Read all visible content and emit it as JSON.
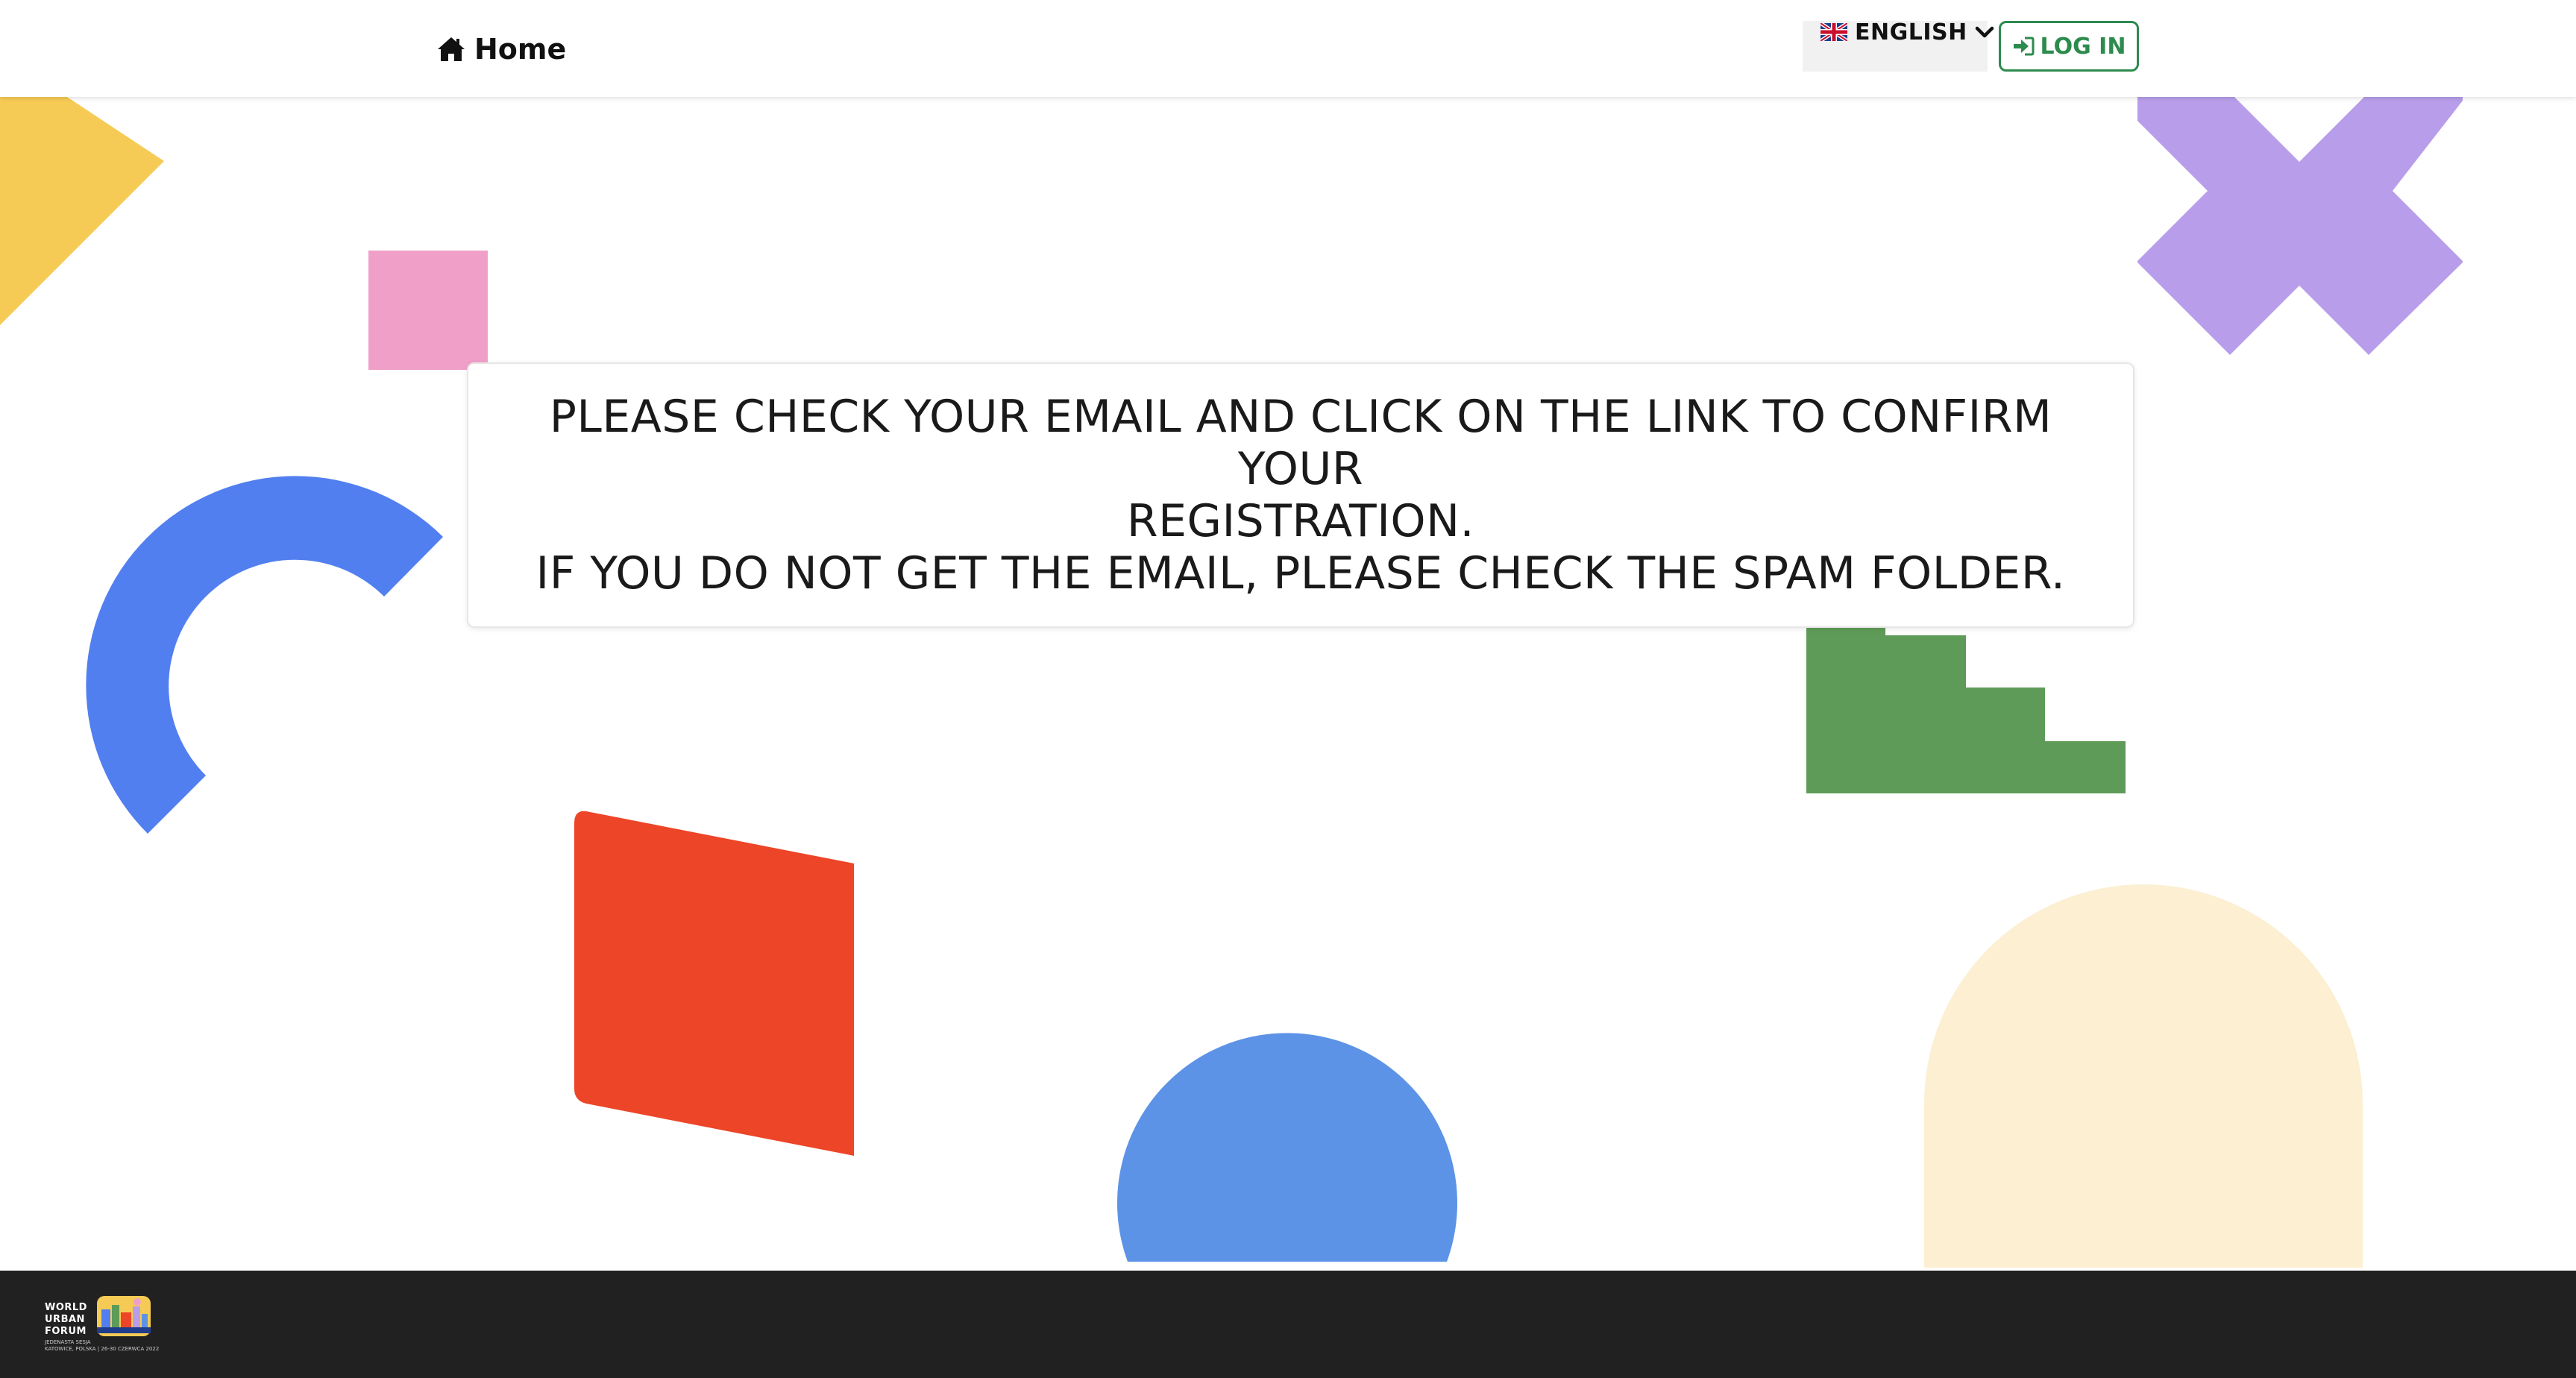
{
  "header": {
    "home_label": "Home",
    "language": {
      "selected": "ENGLISH",
      "flag": "uk-flag-icon"
    },
    "login_label": "LOG IN"
  },
  "message": {
    "line1": "PLEASE CHECK YOUR EMAIL AND CLICK ON THE LINK TO CONFIRM YOUR",
    "line2": "REGISTRATION.",
    "line3": "IF YOU DO NOT GET THE EMAIL, PLEASE CHECK THE SPAM FOLDER."
  },
  "footer": {
    "logo_text_lines": [
      "WORLD",
      "URBAN",
      "FORUM"
    ],
    "logo_subtitle": "KATOWICE, POLSKA | 26-30 CZERWCA 2022",
    "logo_tagline": "JEDENASTA SESJA"
  },
  "colors": {
    "accent_green": "#2d8b4e",
    "shape_yellow": "#f6cb55",
    "shape_pink": "#f0a0c8",
    "shape_purple": "#b89eea",
    "shape_blue_arc": "#527ff0",
    "shape_green": "#5e9b58",
    "shape_red": "#ec4527",
    "shape_blue_circle": "#5d93e6",
    "shape_cream": "#fcefd2",
    "footer_bg": "#212121"
  }
}
